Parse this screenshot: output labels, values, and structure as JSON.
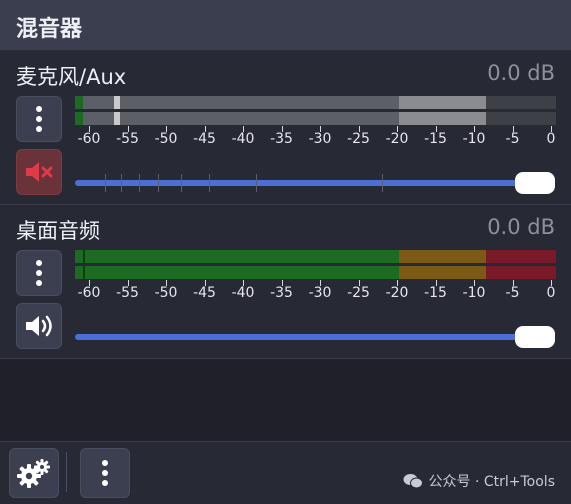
{
  "header": {
    "title": "混音器"
  },
  "meter_scale": [
    "-60",
    "-55",
    "-50",
    "-45",
    "-40",
    "-35",
    "-30",
    "-25",
    "-20",
    "-15",
    "-10",
    "-5",
    "0"
  ],
  "channels": [
    {
      "name": "麦克风/Aux",
      "level": "0.0 dB",
      "muted": true,
      "volume_fraction": 1.0,
      "meter_style": "inactive-grey",
      "menu_icon": "vertical-dots-icon",
      "mute_icon": "speaker-muted-icon"
    },
    {
      "name": "桌面音频",
      "level": "0.0 dB",
      "muted": false,
      "volume_fraction": 1.0,
      "meter_style": "active-color",
      "menu_icon": "vertical-dots-icon",
      "mute_icon": "speaker-volume-icon"
    }
  ],
  "footer": {
    "settings_icon": "gears-icon",
    "menu_icon": "vertical-dots-icon",
    "watermark": "公众号 · Ctrl+Tools"
  },
  "colors": {
    "accent": "#4c6fd6",
    "meter_green": "#1d6b22",
    "meter_yellow": "#7a5a14",
    "meter_red": "#7a1a28",
    "muted_button": "#6a3239"
  }
}
